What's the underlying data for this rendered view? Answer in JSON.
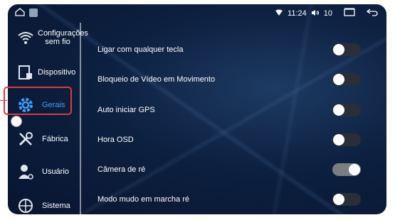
{
  "status": {
    "time": "11:24",
    "volume": "10"
  },
  "sidebar": {
    "items": [
      {
        "label": "Configurações sem fio",
        "icon": "wifi-icon"
      },
      {
        "label": "Dispositivo",
        "icon": "device-icon"
      },
      {
        "label": "Gerais",
        "icon": "gear-icon"
      },
      {
        "label": "Fábrica",
        "icon": "tools-icon"
      },
      {
        "label": "Usuário",
        "icon": "user-icon"
      },
      {
        "label": "Sistema",
        "icon": "system-icon"
      }
    ],
    "active": "Gerais"
  },
  "settings": [
    {
      "label": "Ligar com qualquer tecla",
      "on": false
    },
    {
      "label": "Bloqueio de Vídeo em Movimento",
      "on": false
    },
    {
      "label": "Auto iniciar GPS",
      "on": false
    },
    {
      "label": "Hora OSD",
      "on": false
    },
    {
      "label": "Câmera de ré",
      "on": true
    },
    {
      "label": "Modo mudo em marcha ré",
      "on": false
    }
  ],
  "colors": {
    "accent": "#3aa0ff",
    "highlight": "#e03a3a"
  }
}
